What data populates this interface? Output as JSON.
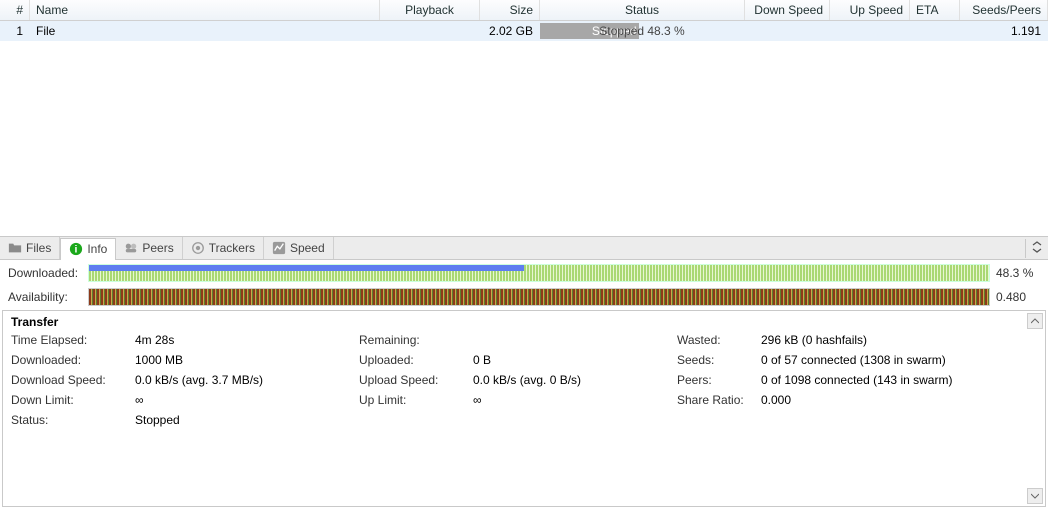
{
  "columns": {
    "idx": "#",
    "name": "Name",
    "playback": "Playback",
    "size": "Size",
    "status": "Status",
    "down": "Down Speed",
    "up": "Up Speed",
    "eta": "ETA",
    "sp": "Seeds/Peers"
  },
  "row1": {
    "idx": "1",
    "name": "File",
    "size": "2.02 GB",
    "status_text": "Stopped 48.3 %",
    "status_inner": "Stopped",
    "sp": "1.191"
  },
  "tabs": {
    "files": "Files",
    "info": "Info",
    "peers": "Peers",
    "trackers": "Trackers",
    "speed": "Speed"
  },
  "bars": {
    "dl_label": "Downloaded:",
    "dl_pct": "48.3 %",
    "av_label": "Availability:",
    "av_val": "0.480"
  },
  "transfer": {
    "header": "Transfer",
    "time_elapsed_l": "Time Elapsed:",
    "time_elapsed": "4m 28s",
    "remaining_l": "Remaining:",
    "remaining": "",
    "wasted_l": "Wasted:",
    "wasted": "296 kB (0 hashfails)",
    "downloaded_l": "Downloaded:",
    "downloaded": "1000 MB",
    "uploaded_l": "Uploaded:",
    "uploaded": "0 B",
    "seeds_l": "Seeds:",
    "seeds": "0 of 57 connected (1308 in swarm)",
    "dlspeed_l": "Download Speed:",
    "dlspeed": "0.0 kB/s (avg. 3.7 MB/s)",
    "ulspeed_l": "Upload Speed:",
    "ulspeed": "0.0 kB/s (avg. 0 B/s)",
    "peers_l": "Peers:",
    "peers": "0 of 1098 connected (143 in swarm)",
    "dnlimit_l": "Down Limit:",
    "dnlimit": "∞",
    "uplimit_l": "Up Limit:",
    "uplimit": "∞",
    "ratio_l": "Share Ratio:",
    "ratio": "0.000",
    "status_l": "Status:",
    "status": "Stopped"
  }
}
